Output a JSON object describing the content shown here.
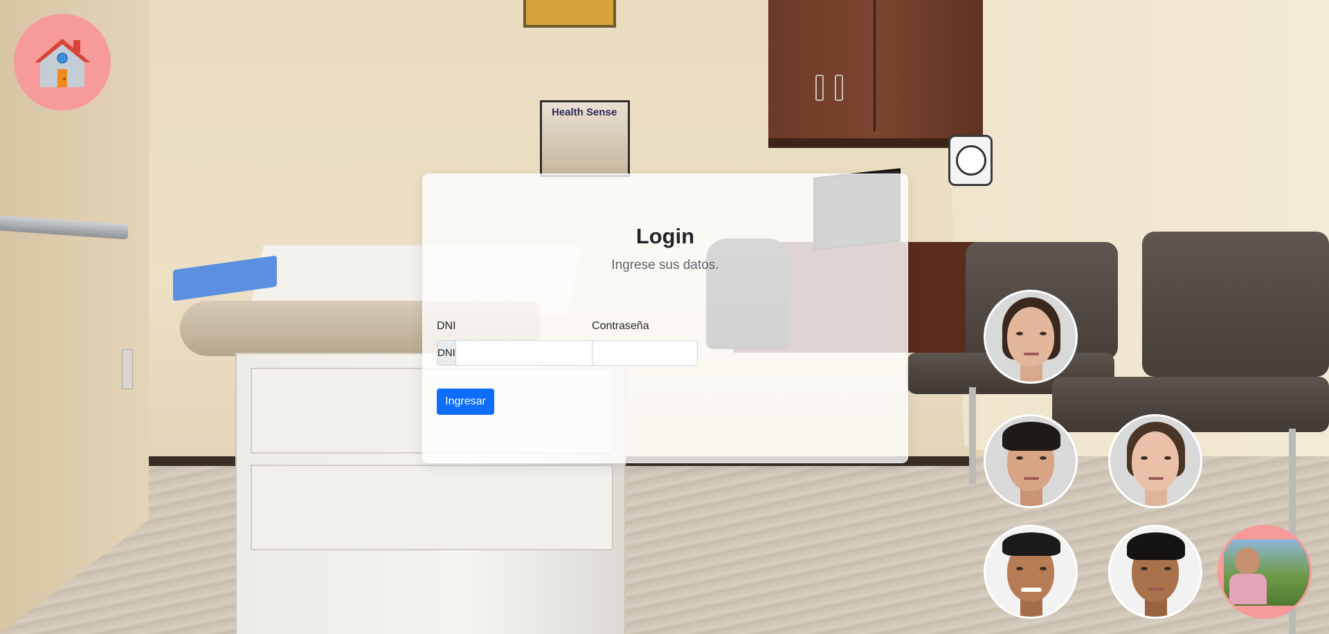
{
  "app": {
    "home_icon": "house-icon"
  },
  "login": {
    "title": "Login",
    "subtitle": "Ingrese sus datos.",
    "dni_label": "DNI",
    "dni_addon": "DNI",
    "dni_value": "",
    "password_label": "Contraseña",
    "password_value": "",
    "submit_label": "Ingresar"
  },
  "background": {
    "brochure_text": "Health Sense"
  },
  "avatars": [
    {
      "id": "avatar-woman-1",
      "skin": "#e2b79b",
      "hair": "#3a271d"
    },
    {
      "id": "avatar-man-1",
      "skin": "#d7a585",
      "hair": "#1e1a17"
    },
    {
      "id": "avatar-woman-2",
      "skin": "#eac0a8",
      "hair": "#4a3426"
    },
    {
      "id": "avatar-man-2",
      "skin": "#b57c55",
      "hair": "#1c1b1a"
    },
    {
      "id": "avatar-man-3",
      "skin": "#a9714c",
      "hair": "#161413"
    },
    {
      "id": "avatar-photo-outdoor",
      "bg": "#f79a9a"
    }
  ],
  "colors": {
    "primary": "#0d6efd",
    "home_bg": "#f79a9a",
    "card_bg": "rgba(255,255,255,0.80)"
  }
}
